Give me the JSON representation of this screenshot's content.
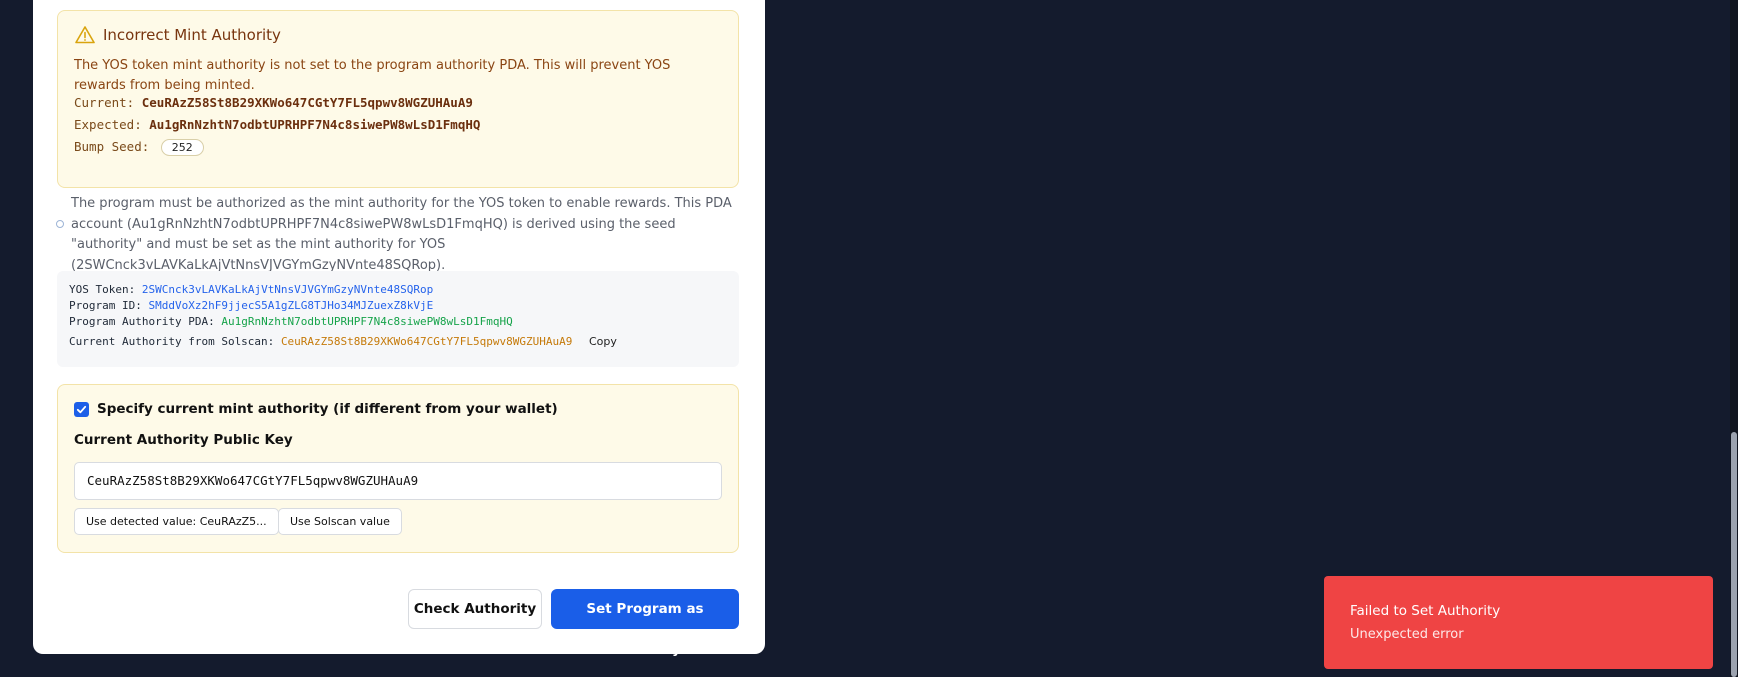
{
  "alert": {
    "title": "Incorrect Mint Authority",
    "description": "The YOS token mint authority is not set to the program authority PDA. This will prevent YOS rewards from being minted.",
    "current_label": "Current:",
    "current_value": "CeuRAzZ58St8B29XKWo647CGtY7FL5qpwv8WGZUHAuA9",
    "expected_label": "Expected:",
    "expected_value": "Au1gRnNzhtN7odbtUPRHPF7N4c8siwePW8wLsD1FmqHQ",
    "bump_label": "Bump Seed:",
    "bump_value": "252"
  },
  "info": {
    "text": "The program must be authorized as the mint authority for the YOS token to enable rewards. This PDA account (Au1gRnNzhtN7odbtUPRHPF7N4c8siwePW8wLsD1FmqHQ) is derived using the seed \"authority\" and must be set as the mint authority for YOS (2SWCnck3vLAVKaLkAjVtNnsVJVGYmGzyNVnte48SQRop)."
  },
  "code": {
    "yos_label": "YOS Token:",
    "yos_value": "2SWCnck3vLAVKaLkAjVtNnsVJVGYmGzyNVnte48SQRop",
    "program_label": "Program ID:",
    "program_value": "SMddVoXz2hF9jjecS5A1gZLG8TJHo34MJZuexZ8kVjE",
    "pda_label": "Program Authority PDA:",
    "pda_value": "Au1gRnNzhtN7odbtUPRHPF7N4c8siwePW8wLsD1FmqHQ",
    "solscan_label": "Current Authority from Solscan:",
    "solscan_value": "CeuRAzZ58St8B29XKWo647CGtY7FL5qpwv8WGZUHAuA9",
    "copy_label": "Copy"
  },
  "authority_form": {
    "checkbox_label": "Specify current mint authority (if different from your wallet)",
    "checked": true,
    "field_label": "Current Authority Public Key",
    "input_value": "CeuRAzZ58St8B29XKWo647CGtY7FL5qpwv8WGZUHAuA9",
    "detected_button": "Use detected value: CeuRAzZ5...",
    "solscan_button": "Use Solscan value"
  },
  "actions": {
    "check_label": "Check Authority",
    "set_label": "Set Program as Authority"
  },
  "toast": {
    "title": "Failed to Set Authority",
    "message": "Unexpected error"
  },
  "colors": {
    "primary": "#1a5ee8",
    "error": "#ef4444",
    "warning_bg": "#fefae8",
    "page_bg": "#141b2d"
  }
}
